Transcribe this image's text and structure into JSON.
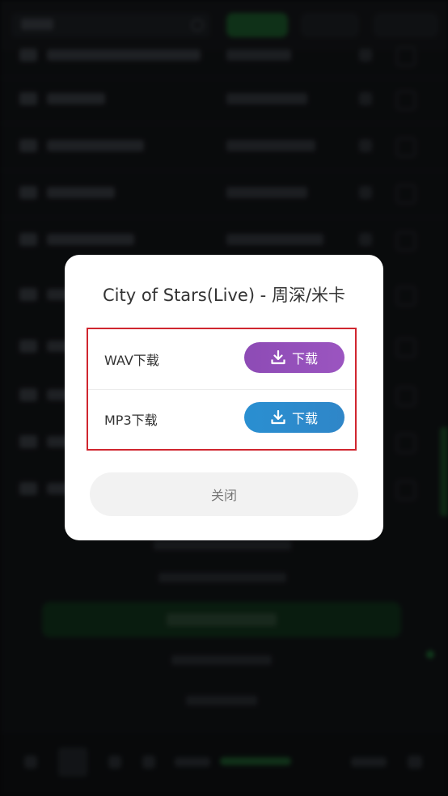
{
  "modal": {
    "title": "City of Stars(Live) - 周深/米卡",
    "options": [
      {
        "label": "WAV下载",
        "button_label": "下载",
        "color": "#9650bb"
      },
      {
        "label": "MP3下载",
        "button_label": "下载",
        "color": "#2d8bcd"
      }
    ],
    "close_label": "关闭",
    "highlight_color": "#d0262f"
  }
}
